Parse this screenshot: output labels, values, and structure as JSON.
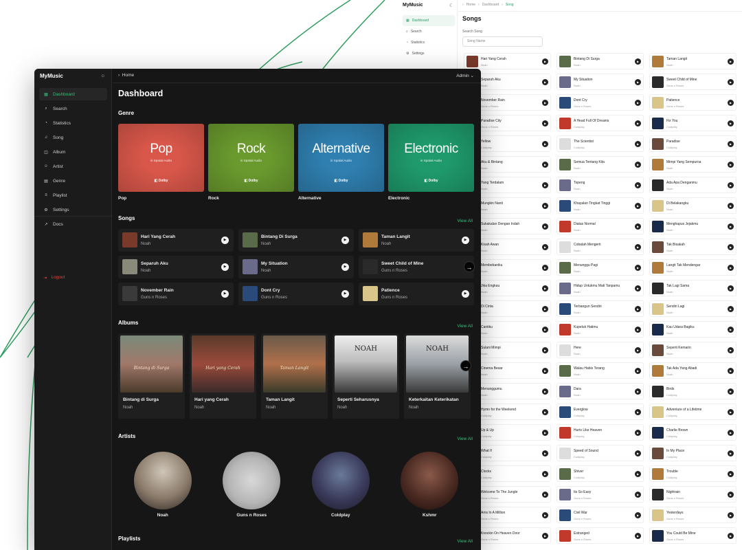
{
  "colors": {
    "accent": "#36c07a",
    "logout": "#e2453c",
    "dark_bg": "#161616"
  },
  "light_app": {
    "brand": "MyMusic",
    "theme_icon": "moon-icon",
    "nav": [
      {
        "label": "Dashboard",
        "icon": "grid-icon",
        "active": true
      },
      {
        "label": "Search",
        "icon": "search-icon"
      },
      {
        "label": "Statistics",
        "icon": "chart-icon"
      },
      {
        "label": "Settings",
        "icon": "gear-icon"
      }
    ],
    "breadcrumb": [
      "Home",
      "Dashboard",
      "Song"
    ],
    "title": "Songs",
    "search_label": "Search Song",
    "search_placeholder": "Song Name",
    "songs": [
      {
        "name": "Hari Yang Cerah",
        "artist": "Noah"
      },
      {
        "name": "Bintang Di Surga",
        "artist": "Noah"
      },
      {
        "name": "Taman Langit",
        "artist": "Noah"
      },
      {
        "name": "Separuh Aku",
        "artist": "Noah"
      },
      {
        "name": "My Situation",
        "artist": "Noah"
      },
      {
        "name": "Sweet Child of Mine",
        "artist": "Guns n Roses"
      },
      {
        "name": "November Rain",
        "artist": "Guns n Roses"
      },
      {
        "name": "Dont Cry",
        "artist": "Guns n Roses"
      },
      {
        "name": "Patience",
        "artist": "Guns n Roses"
      },
      {
        "name": "Paradise City",
        "artist": "Guns n Roses"
      },
      {
        "name": "A Head Full Of Dreams",
        "artist": "Coldplay"
      },
      {
        "name": "Fix You",
        "artist": "Coldplay"
      },
      {
        "name": "Yellow",
        "artist": "Coldplay"
      },
      {
        "name": "The Scientist",
        "artist": "Coldplay"
      },
      {
        "name": "Paradise",
        "artist": "Coldplay"
      },
      {
        "name": "Aku & Bintang",
        "artist": "Noah"
      },
      {
        "name": "Semua Tentang Kita",
        "artist": "Noah"
      },
      {
        "name": "Mimpi Yang Sempurna",
        "artist": "Noah"
      },
      {
        "name": "Yang Terdalam",
        "artist": "Noah"
      },
      {
        "name": "Topeng",
        "artist": "Noah"
      },
      {
        "name": "Ada Apa Denganmu",
        "artist": "Noah"
      },
      {
        "name": "Mungkin Nanti",
        "artist": "Noah"
      },
      {
        "name": "Khayalan Tingkat Tinggi",
        "artist": "Noah"
      },
      {
        "name": "Di Belakangku",
        "artist": "Noah"
      },
      {
        "name": "Sukakalan Dengan Indah",
        "artist": "Noah"
      },
      {
        "name": "Diatas Normal",
        "artist": "Noah"
      },
      {
        "name": "Menghapus Jejakmu",
        "artist": "Noah"
      },
      {
        "name": "Kisah Awan",
        "artist": "Noah"
      },
      {
        "name": "Cobalah Mengerti",
        "artist": "Noah"
      },
      {
        "name": "Tak Bisakah",
        "artist": "Noah"
      },
      {
        "name": "Membebaniku",
        "artist": "Noah"
      },
      {
        "name": "Menunggu Pagi",
        "artist": "Noah"
      },
      {
        "name": "Langit Tak Mendengar",
        "artist": "Noah"
      },
      {
        "name": "Jika Engkau",
        "artist": "Noah"
      },
      {
        "name": "Hidup Untukmu Mati Tanpamu",
        "artist": "Noah"
      },
      {
        "name": "Tak Lagi Sama",
        "artist": "Noah"
      },
      {
        "name": "Di Cinta",
        "artist": "Noah"
      },
      {
        "name": "Terbangun Sendiri",
        "artist": "Noah"
      },
      {
        "name": "Sendiri Lagi",
        "artist": "Noah"
      },
      {
        "name": "Cantiku",
        "artist": "Noah"
      },
      {
        "name": "Kupeluk Hatimu",
        "artist": "Noah"
      },
      {
        "name": "Kau Udara Bagiku",
        "artist": "Noah"
      },
      {
        "name": "Sulani Mimpi",
        "artist": "Noah"
      },
      {
        "name": "Here",
        "artist": "Noah"
      },
      {
        "name": "Seperti Kemarin",
        "artist": "Noah"
      },
      {
        "name": "Cinema Besar",
        "artist": "Noah"
      },
      {
        "name": "Walau Habis Terang",
        "artist": "Noah"
      },
      {
        "name": "Tak Ada Yang Abadi",
        "artist": "Noah"
      },
      {
        "name": "Menunggumu",
        "artist": "Noah"
      },
      {
        "name": "Dara",
        "artist": "Noah"
      },
      {
        "name": "Birds",
        "artist": "Coldplay"
      },
      {
        "name": "Hymn for the Weekend",
        "artist": "Coldplay"
      },
      {
        "name": "Everglow",
        "artist": "Coldplay"
      },
      {
        "name": "Adventure of a Lifetime",
        "artist": "Coldplay"
      },
      {
        "name": "Up & Up",
        "artist": "Coldplay"
      },
      {
        "name": "Hurts Like Heaven",
        "artist": "Coldplay"
      },
      {
        "name": "Charlie Brown",
        "artist": "Coldplay"
      },
      {
        "name": "What If",
        "artist": "Coldplay"
      },
      {
        "name": "Speed of Sound",
        "artist": "Coldplay"
      },
      {
        "name": "In My Place",
        "artist": "Coldplay"
      },
      {
        "name": "Clocks",
        "artist": "Coldplay"
      },
      {
        "name": "Shiver",
        "artist": "Coldplay"
      },
      {
        "name": "Trouble",
        "artist": "Coldplay"
      },
      {
        "name": "Welcome To The Jungle",
        "artist": "Guns n Roses"
      },
      {
        "name": "Its So Easy",
        "artist": "Guns n Roses"
      },
      {
        "name": "Nightrain",
        "artist": "Guns n Roses"
      },
      {
        "name": "Ams In A Million",
        "artist": "Guns n Roses"
      },
      {
        "name": "Civil War",
        "artist": "Guns n Roses"
      },
      {
        "name": "Yesterdays",
        "artist": "Guns n Roses"
      },
      {
        "name": "Knockin On Heaven Door",
        "artist": "Guns n Roses"
      },
      {
        "name": "Estranged",
        "artist": "Guns n Roses"
      },
      {
        "name": "You Could Be Mine",
        "artist": "Guns n Roses"
      }
    ]
  },
  "dark_app": {
    "brand": "MyMusic",
    "theme_icon": "sun-icon",
    "nav": [
      {
        "label": "Dashboard",
        "icon": "grid-icon",
        "active": true
      },
      {
        "label": "Search",
        "icon": "search-icon"
      },
      {
        "label": "Statistics",
        "icon": "chart-icon"
      },
      {
        "label": "Song",
        "icon": "music-note-icon"
      },
      {
        "label": "Album",
        "icon": "album-icon"
      },
      {
        "label": "Artist",
        "icon": "people-icon"
      },
      {
        "label": "Genre",
        "icon": "tag-icon"
      },
      {
        "label": "Playlist",
        "icon": "list-icon"
      },
      {
        "label": "Settings",
        "icon": "gear-icon"
      },
      {
        "label": "Docs",
        "icon": "external-link-icon"
      }
    ],
    "logout": "Logout",
    "breadcrumb": "Home",
    "user": "Admin",
    "title": "Dashboard",
    "genre_heading": "Genre",
    "genres": [
      {
        "name": "Pop",
        "label": "Pop",
        "subtitle": "in Spatial Audio",
        "badge": "Dolby",
        "color": "#d9574a"
      },
      {
        "name": "Rock",
        "label": "Rock",
        "subtitle": "in Spatial Audio",
        "badge": "Dolby",
        "color": "#6a9a2e"
      },
      {
        "name": "Alternative",
        "label": "Alternative",
        "subtitle": "in Spatial Audio",
        "badge": "Dolby",
        "color": "#2f7fb0"
      },
      {
        "name": "Electronic",
        "label": "Electronic",
        "subtitle": "in Spatial Audio",
        "badge": "Dolby",
        "color": "#1f9a6c"
      }
    ],
    "songs_heading": "Songs",
    "view_all": "View All",
    "songs": [
      {
        "name": "Hari Yang Cerah",
        "artist": "Noah"
      },
      {
        "name": "Bintang Di Surga",
        "artist": "Noah"
      },
      {
        "name": "Taman Langit",
        "artist": "Noah"
      },
      {
        "name": "Separuh Aku",
        "artist": "Noah"
      },
      {
        "name": "My Situation",
        "artist": "Noah"
      },
      {
        "name": "Sweet Child of Mine",
        "artist": "Guns n Roses"
      },
      {
        "name": "November Rain",
        "artist": "Guns n Roses"
      },
      {
        "name": "Dont Cry",
        "artist": "Guns n Roses"
      },
      {
        "name": "Patience",
        "artist": "Guns n Roses"
      }
    ],
    "albums_heading": "Albums",
    "albums": [
      {
        "name": "Bintang di Surga",
        "artist": "Noah",
        "cover_text": "Bintang di Surga"
      },
      {
        "name": "Hari yang Cerah",
        "artist": "Noah",
        "cover_text": "Hari yang Cerah"
      },
      {
        "name": "Taman Langit",
        "artist": "Noah",
        "cover_text": "Taman Langit"
      },
      {
        "name": "Seperti Seharusnya",
        "artist": "Noah",
        "cover_text": "NOAH"
      },
      {
        "name": "Keterkaitan Keterikatan",
        "artist": "Noah",
        "cover_text": "NOAH"
      }
    ],
    "artists_heading": "Artists",
    "artists": [
      {
        "name": "Noah"
      },
      {
        "name": "Guns n Roses"
      },
      {
        "name": "Coldplay"
      },
      {
        "name": "Kshmr"
      }
    ],
    "playlists_heading": "Playlists"
  }
}
